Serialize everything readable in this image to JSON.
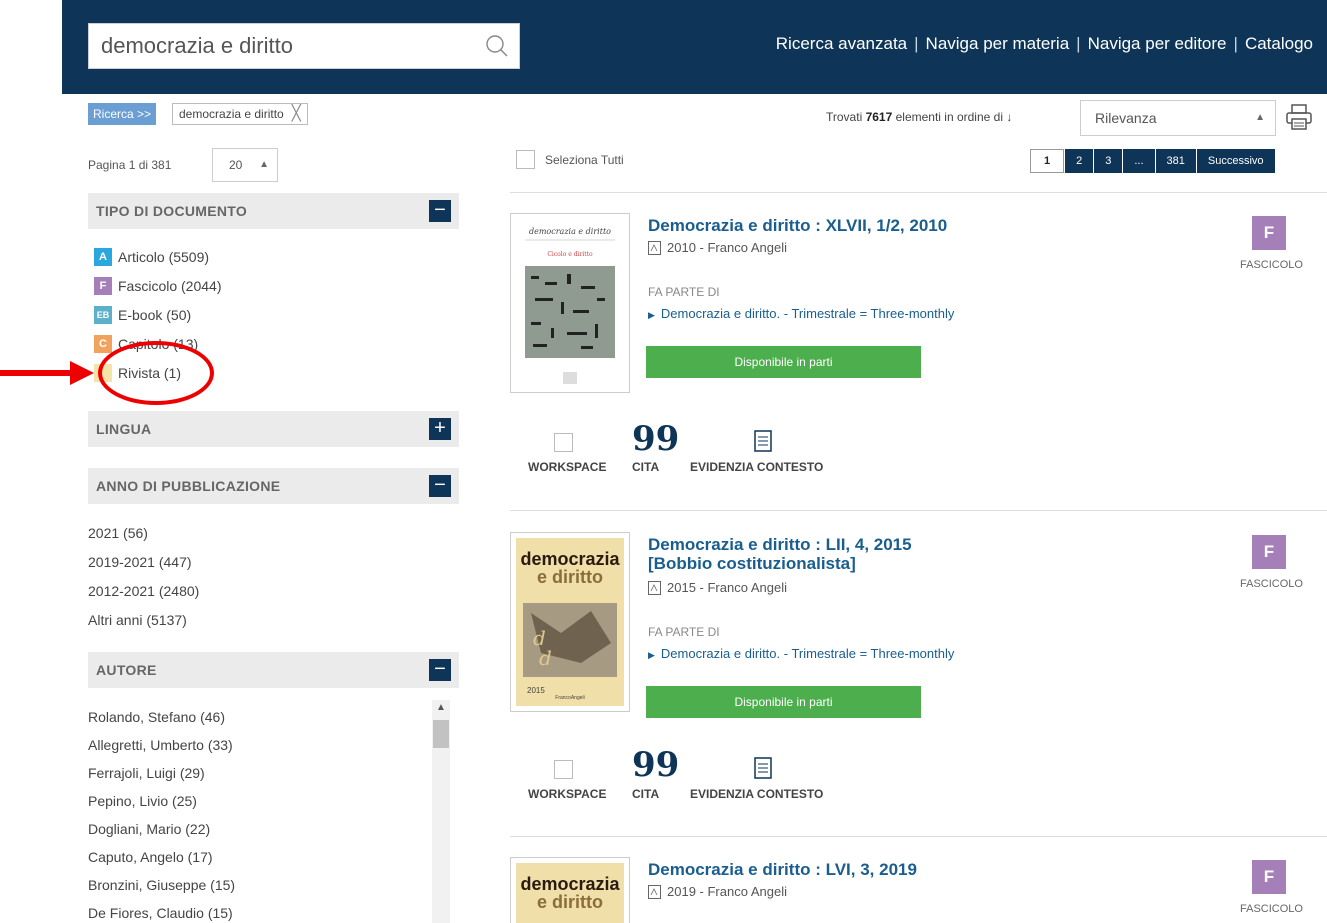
{
  "header": {
    "search_value": "democrazia e diritto",
    "nav": [
      "Ricerca avanzata",
      "Naviga per materia",
      "Naviga per editore",
      "Catalogo"
    ]
  },
  "breadcrumb": {
    "ricerca": "Ricerca >>",
    "query": "democrazia e diritto",
    "remove": "╳"
  },
  "paging": {
    "info": "Pagina 1 di 381",
    "per_page": "20",
    "pages": [
      "1",
      "2",
      "3",
      "...",
      "381",
      "Successivo"
    ]
  },
  "facets": {
    "tipo": {
      "title": "TIPO DI DOCUMENTO",
      "toggle": "−",
      "items": [
        {
          "badge": "A",
          "label": "Articolo (5509)"
        },
        {
          "badge": "F",
          "label": "Fascicolo (2044)"
        },
        {
          "badge": "EB",
          "label": "E-book (50)"
        },
        {
          "badge": "C",
          "label": "Capitolo (13)"
        },
        {
          "badge": "",
          "label": "Rivista (1)"
        }
      ]
    },
    "lingua": {
      "title": "LINGUA",
      "toggle": "+"
    },
    "anno": {
      "title": "ANNO DI PUBBLICAZIONE",
      "toggle": "−",
      "items": [
        "2021  (56)",
        "2019-2021  (447)",
        "2012-2021  (2480)",
        "Altri anni  (5137)"
      ]
    },
    "autore": {
      "title": "AUTORE",
      "toggle": "−",
      "items": [
        "Rolando, Stefano (46)",
        "Allegretti, Umberto (33)",
        "Ferrajoli, Luigi (29)",
        "Pepino, Livio (25)",
        "Dogliani, Mario (22)",
        "Caputo, Angelo (17)",
        "Bronzini, Giuseppe (15)",
        "De Fiores, Claudio (15)"
      ]
    }
  },
  "results_header": {
    "found_pre": "Trovati ",
    "found_count": "7617",
    "found_post": " elementi in ordine di ↓",
    "sort_value": "Rilevanza",
    "select_all": "Seleziona Tutti"
  },
  "results": [
    {
      "title_line1": "Democrazia e diritto : XLVII, 1/2, 2010",
      "title_line2": "",
      "meta": "2010 - Franco Angeli",
      "fa_parte": "FA PARTE DI",
      "parent": "Democrazia e diritto. - Trimestrale = Three-monthly",
      "available": "Disponibile in parti",
      "type_badge": "F",
      "type_label": "FASCICOLO",
      "cover_title": "democrazia e diritto",
      "cover_sub": "Cicolo e diritto"
    },
    {
      "title_line1": "Democrazia e diritto : LII, 4, 2015",
      "title_line2": "[Bobbio costituzionalista]",
      "meta": "2015 - Franco Angeli",
      "fa_parte": "FA PARTE DI",
      "parent": "Democrazia e diritto. - Trimestrale = Three-monthly",
      "available": "Disponibile in parti",
      "type_badge": "F",
      "type_label": "FASCICOLO",
      "cover_title": "democrazia",
      "cover_sub": "e diritto",
      "cover_year": "2015",
      "cover_pub": "FrancoAngeli"
    },
    {
      "title_line1": "Democrazia e diritto : LVI, 3, 2019",
      "title_line2": "",
      "meta": "2019 - Franco Angeli",
      "type_badge": "F",
      "type_label": "FASCICOLO",
      "cover_title": "democrazia",
      "cover_sub": "e diritto"
    }
  ],
  "actions": {
    "workspace": "WORKSPACE",
    "cita": "CITA",
    "cita_glyph": "99",
    "contesto": "EVIDENZIA CONTESTO"
  },
  "colors": {
    "header_bg": "#0e3557",
    "link": "#1a5d8f",
    "available_green": "#4cae4c",
    "fascicolo_purple": "#a57fb8",
    "annotation_red": "#ee0000"
  }
}
